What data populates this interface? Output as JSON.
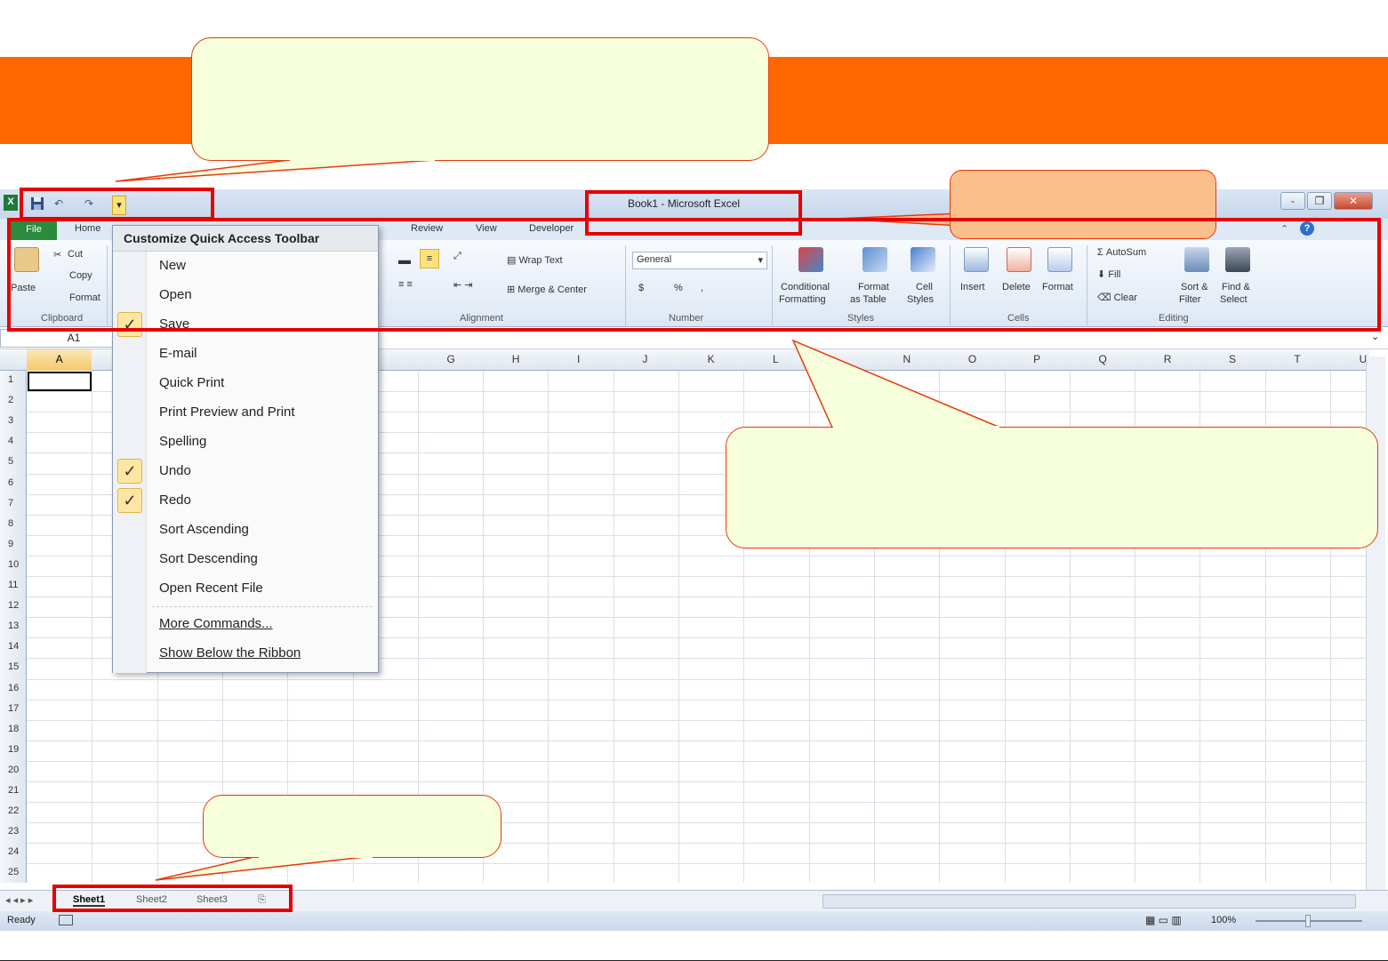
{
  "colors": {
    "banner": "#ff6600",
    "highlight": "#e60000",
    "callout_yellow": "#f6fedc",
    "callout_peach": "#fbbf8c",
    "file_tab": "#2a8a3e"
  },
  "title_bar": {
    "title": "Book1 - Microsoft Excel",
    "minimize": "-",
    "restore": "❐",
    "close": "✕"
  },
  "qat": {
    "save_icon": "floppy-disk-icon",
    "undo": "↶",
    "redo": "↷",
    "dropdown": "▾"
  },
  "tabs": {
    "file": "File",
    "home": "Home",
    "review": "Review",
    "view": "View",
    "developer": "Developer"
  },
  "ribbon": {
    "clipboard": {
      "paste": "Paste",
      "cut": "Cut",
      "copy": "Copy",
      "format": "Format",
      "label": "Clipboard"
    },
    "alignment": {
      "wrap_text": "Wrap Text",
      "merge_center": "Merge & Center",
      "label": "Alignment"
    },
    "number": {
      "format_value": "General",
      "currency": "$",
      "percent": "%",
      "comma": ",",
      "label": "Number"
    },
    "styles": {
      "conditional": "Conditional",
      "conditional2": "Formatting",
      "format_table": "Format",
      "format_table2": "as Table",
      "cell_styles": "Cell",
      "cell_styles2": "Styles",
      "label": "Styles"
    },
    "cells": {
      "insert": "Insert",
      "delete": "Delete",
      "format": "Format",
      "label": "Cells"
    },
    "editing": {
      "autosum": "AutoSum",
      "fill": "Fill",
      "clear": "Clear",
      "sort": "Sort &",
      "sort2": "Filter",
      "find": "Find &",
      "find2": "Select",
      "label": "Editing"
    }
  },
  "name_box": "A1",
  "columns": [
    "A",
    "",
    "",
    "",
    "",
    "",
    "G",
    "H",
    "I",
    "J",
    "K",
    "L",
    "",
    "N",
    "O",
    "P",
    "Q",
    "R",
    "S",
    "T",
    "U"
  ],
  "rows": [
    "1",
    "2",
    "3",
    "4",
    "5",
    "6",
    "7",
    "8",
    "9",
    "10",
    "11",
    "12",
    "13",
    "14",
    "15",
    "16",
    "17",
    "18",
    "19",
    "20",
    "21",
    "22",
    "23",
    "24",
    "25"
  ],
  "sheets": [
    "Sheet1",
    "Sheet2",
    "Sheet3"
  ],
  "status": {
    "ready": "Ready",
    "zoom": "100%"
  },
  "menu": {
    "header": "Customize Quick Access Toolbar",
    "items": [
      "New",
      "Open",
      "Save",
      "E-mail",
      "Quick Print",
      "Print Preview and Print",
      "Spelling",
      "Undo",
      "Redo",
      "Sort Ascending",
      "Sort Descending",
      "Open Recent File"
    ],
    "more": "More Commands...",
    "below": "Show Below the Ribbon",
    "check": "✓"
  }
}
